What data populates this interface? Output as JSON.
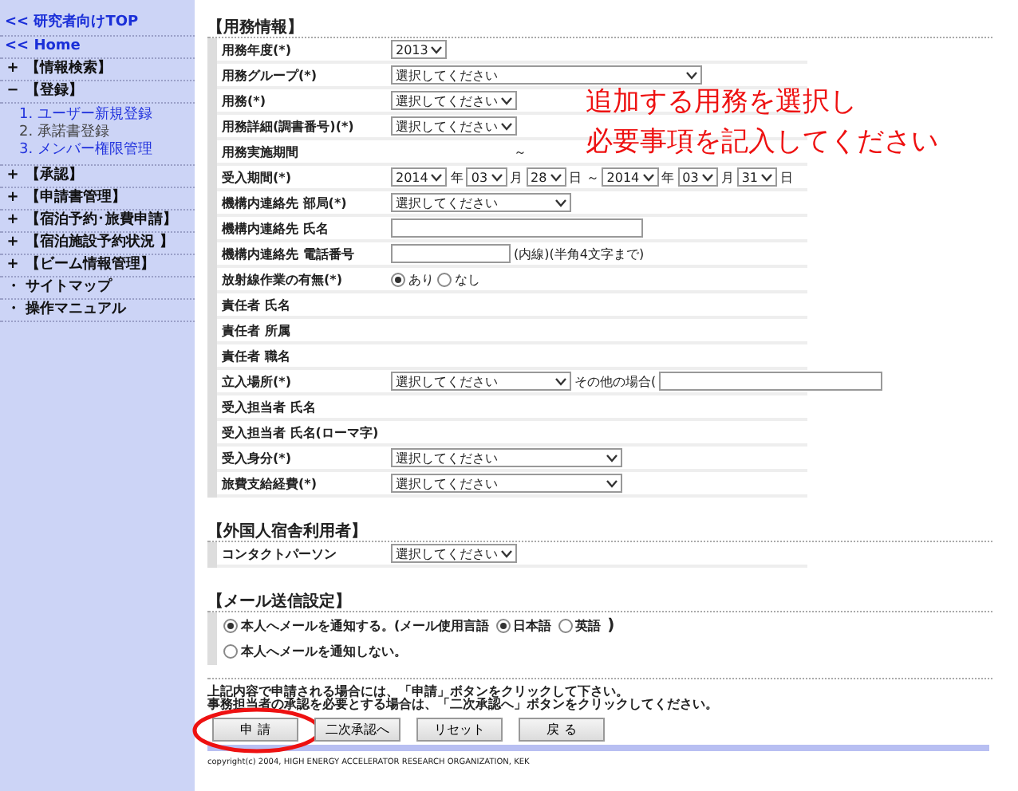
{
  "sidebar": {
    "top_links": [
      "<< 研究者向けTOP",
      "<< Home"
    ],
    "items": [
      {
        "marker": "+",
        "label": "【情報検索】"
      },
      {
        "marker": "−",
        "label": "【登録】",
        "children": [
          {
            "number": "1.",
            "label": "ユーザー新規登録",
            "selected": false
          },
          {
            "number": "2.",
            "label": "承諾書登録",
            "selected": true
          },
          {
            "number": "3.",
            "label": "メンバー権限管理",
            "selected": false
          }
        ]
      },
      {
        "marker": "+",
        "label": "【承認】"
      },
      {
        "marker": "+",
        "label": "【申請書管理】"
      },
      {
        "marker": "+",
        "label": "【宿泊予約･旅費申請】"
      },
      {
        "marker": "+",
        "label": "【宿泊施設予約状況 】"
      },
      {
        "marker": "+",
        "label": "【ビーム情報管理】"
      },
      {
        "marker": "・",
        "label": "サイトマップ"
      },
      {
        "marker": "・",
        "label": "操作マニュアル"
      }
    ]
  },
  "sections": [
    {
      "title": "【用務情報】",
      "rows": [
        {
          "label": "用務年度(*)",
          "parts": [
            {
              "kind": "select",
              "value": "2013"
            }
          ]
        },
        {
          "label": "用務グループ(*)",
          "parts": [
            {
              "kind": "select_full",
              "value": "選択してください"
            }
          ]
        },
        {
          "label": "用務(*)",
          "parts": [
            {
              "kind": "select",
              "value": "選択してください"
            }
          ]
        },
        {
          "label": "用務詳細(調書番号)(*)",
          "parts": [
            {
              "kind": "select",
              "value": "選択してください"
            }
          ]
        },
        {
          "label": "用務実施期間",
          "parts": [
            {
              "kind": "gap"
            },
            {
              "kind": "text",
              "value": "～"
            }
          ]
        },
        {
          "label": "受入期間(*)",
          "parts": [
            {
              "kind": "select",
              "value": "2014"
            },
            {
              "kind": "text",
              "value": "年"
            },
            {
              "kind": "select",
              "value": "03"
            },
            {
              "kind": "text",
              "value": "月"
            },
            {
              "kind": "select",
              "value": "28"
            },
            {
              "kind": "text",
              "value": "日 ～"
            },
            {
              "kind": "select",
              "value": "2014"
            },
            {
              "kind": "text",
              "value": "年"
            },
            {
              "kind": "select",
              "value": "03"
            },
            {
              "kind": "text",
              "value": "月"
            },
            {
              "kind": "select",
              "value": "31"
            },
            {
              "kind": "text",
              "value": "日"
            }
          ]
        },
        {
          "label": "機構内連絡先 部局(*)",
          "parts": [
            {
              "kind": "select_mid",
              "value": "選択してください"
            }
          ]
        },
        {
          "label": "機構内連絡先 氏名",
          "parts": [
            {
              "kind": "input_long"
            }
          ]
        },
        {
          "label": "機構内連絡先 電話番号",
          "parts": [
            {
              "kind": "input_short"
            },
            {
              "kind": "text",
              "value": "(内線)(半角4文字まで)"
            }
          ]
        },
        {
          "label": "放射線作業の有無(*)",
          "parts": [
            {
              "kind": "radio",
              "value": "あり",
              "selected": true
            },
            {
              "kind": "radio",
              "value": "なし",
              "selected": false
            }
          ]
        },
        {
          "label": "責任者 氏名",
          "parts": []
        },
        {
          "label": "責任者 所属",
          "parts": []
        },
        {
          "label": "責任者 職名",
          "parts": []
        },
        {
          "label": "立入場所(*)",
          "parts": [
            {
              "kind": "select_mid",
              "value": "選択してください"
            },
            {
              "kind": "text",
              "value": "その他の場合("
            },
            {
              "kind": "input_mid"
            }
          ]
        },
        {
          "label": "受入担当者 氏名",
          "parts": []
        },
        {
          "label": "受入担当者 氏名(ローマ字)",
          "parts": []
        },
        {
          "label": "受入身分(*)",
          "parts": [
            {
              "kind": "select_long",
              "value": "選択してください"
            }
          ]
        },
        {
          "label": "旅費支給経費(*)",
          "parts": [
            {
              "kind": "select_long",
              "value": "選択してください"
            }
          ]
        }
      ]
    },
    {
      "title": "【外国人宿舎利用者】",
      "rows": [
        {
          "label": "コンタクトパーソン",
          "parts": [
            {
              "kind": "select",
              "value": "選択してください"
            }
          ]
        }
      ]
    }
  ],
  "mail": {
    "title": "【メール送信設定】",
    "lines": [
      [
        {
          "kind": "radio",
          "value": "本人へメールを通知する。(メール使用言語",
          "selected": true
        },
        {
          "kind": "radio",
          "value": "日本語",
          "selected": true
        },
        {
          "kind": "radio",
          "value": "英語",
          "selected": false
        },
        {
          "kind": "text",
          "value": ")"
        }
      ],
      [
        {
          "kind": "radio",
          "value": "本人へメールを通知しない。",
          "selected": false
        }
      ]
    ]
  },
  "instructions": [
    "上記内容で申請される場合には、「申請」ボタンをクリックして下さい。",
    "事務担当者の承認を必要とする場合は、「二次承認へ」ボタンをクリックしてください。"
  ],
  "buttons": [
    {
      "label": "申 請",
      "highlighted": true
    },
    {
      "label": "二次承認へ",
      "highlighted": false
    },
    {
      "label": "リセット",
      "highlighted": false
    },
    {
      "label": "戻 る",
      "highlighted": false
    }
  ],
  "annotation": [
    "追加する用務を選択し",
    "必要事項を記入してください"
  ],
  "copyright": "copyright(c) 2004, HIGH ENERGY ACCELERATOR RESEARCH ORGANIZATION, KEK"
}
